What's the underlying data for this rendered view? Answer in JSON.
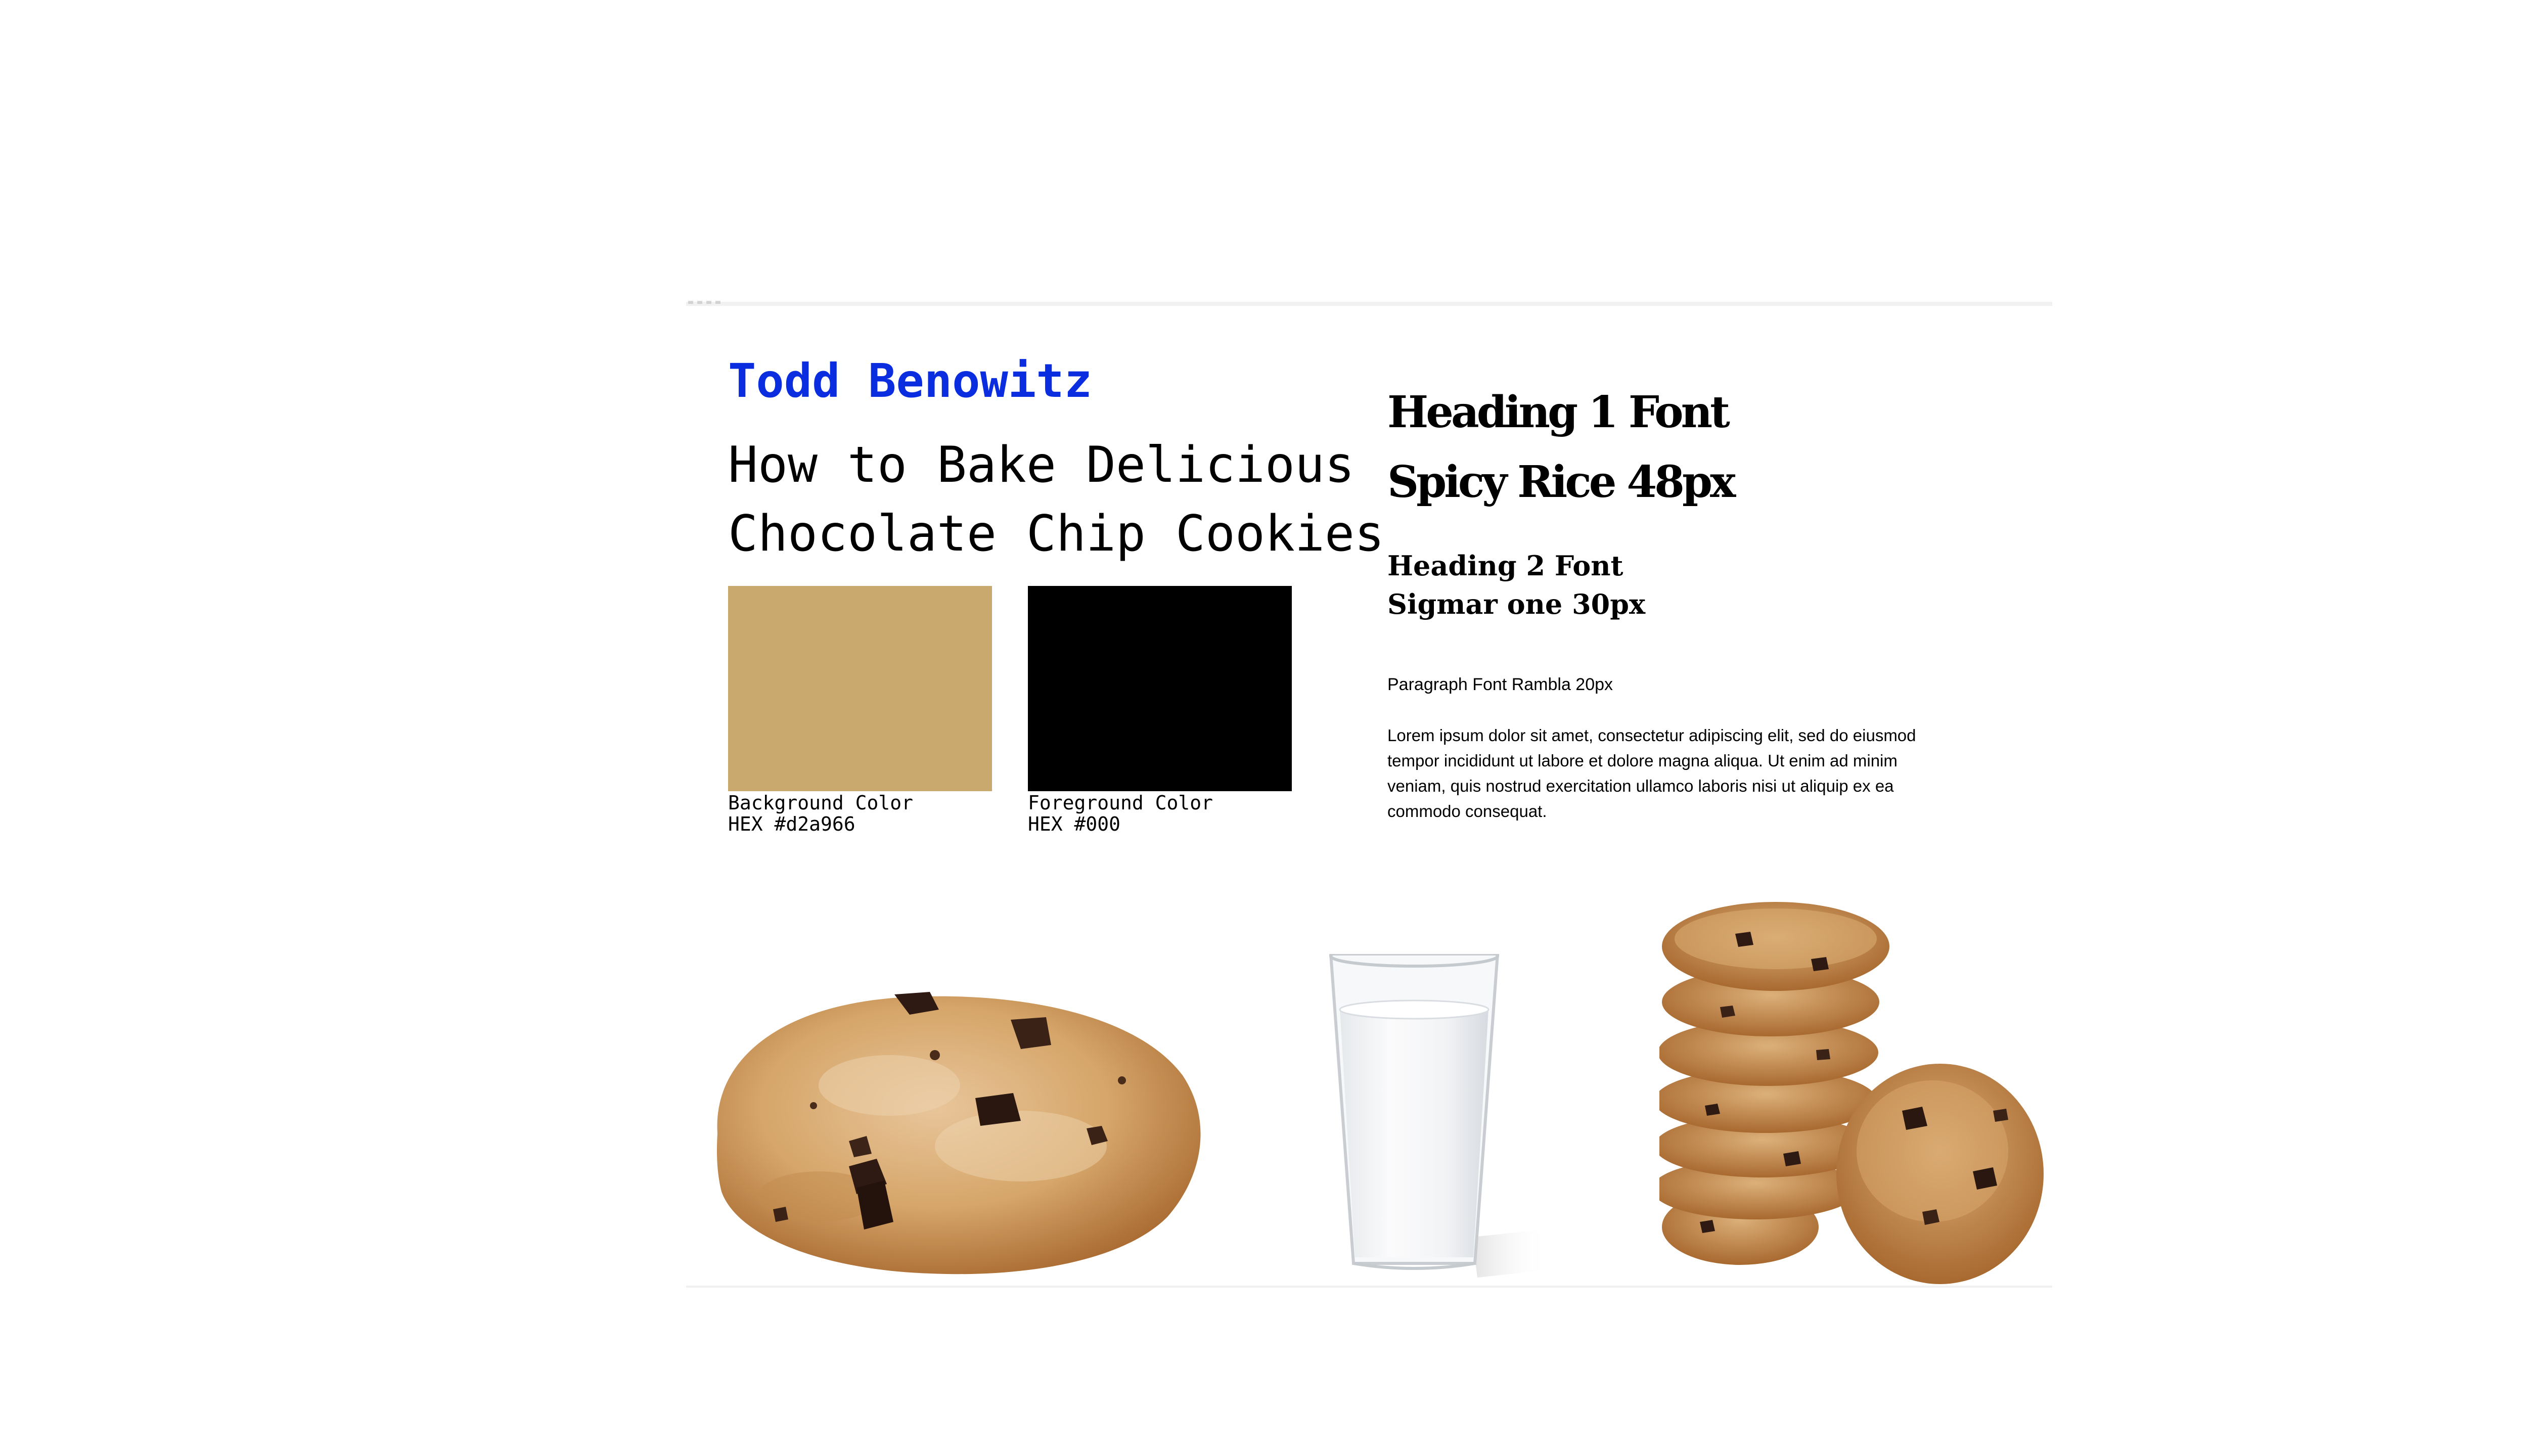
{
  "slide": {
    "author": "Todd Benowitz",
    "title_lines": [
      "How to Bake Delicious",
      "Chocolate Chip Cookies"
    ]
  },
  "swatches": [
    {
      "color": "#c9a96e",
      "label": "Background Color",
      "hex_label": "HEX #d2a966"
    },
    {
      "color": "#000000",
      "label": "Foreground Color",
      "hex_label": "HEX #000"
    }
  ],
  "typography": {
    "heading1_lines": [
      "Heading 1 Font",
      "Spicy Rice 48px"
    ],
    "heading2_lines": [
      "Heading 2 Font",
      "Sigmar one 30px"
    ],
    "paragraph_label": "Paragraph Font Rambla 20px",
    "paragraph_body": "Lorem ipsum dolor sit amet, consectetur adipiscing elit, sed do eiusmod tempor incididunt ut labore et dolore magna aliqua. Ut enim ad minim veniam, quis nostrud exercitation ullamco laboris nisi ut aliquip ex ea commodo consequat."
  },
  "images": {
    "cookie": "chocolate-chip-cookie-image",
    "milk": "glass-of-milk-image",
    "cookie_stack": "stack-of-cookies-image"
  },
  "colors": {
    "author": "#0a2de0",
    "text": "#000000",
    "cookie_light": "#d6a66a",
    "cookie_dark": "#b8783e",
    "chocolate": "#2e1a12"
  }
}
